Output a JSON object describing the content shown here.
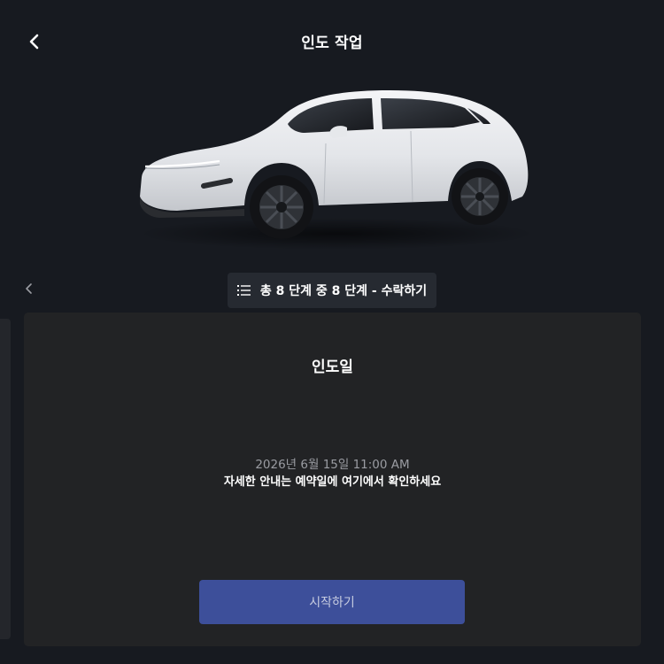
{
  "header": {
    "title": "인도 작업",
    "back_icon": "chevron-left-icon"
  },
  "stepper": {
    "label": "총 8 단계 중 8 단계 - 수락하기",
    "icon": "list-icon",
    "prev_icon": "chevron-left-icon"
  },
  "card": {
    "title": "인도일",
    "date": "2026년 6월 15일 11:00 AM",
    "note": "자세한 안내는 예약일에 여기에서 확인하세요",
    "button_label": "시작하기"
  },
  "colors": {
    "background": "#171a20",
    "card": "#222325",
    "button": "#3d4f9a"
  }
}
